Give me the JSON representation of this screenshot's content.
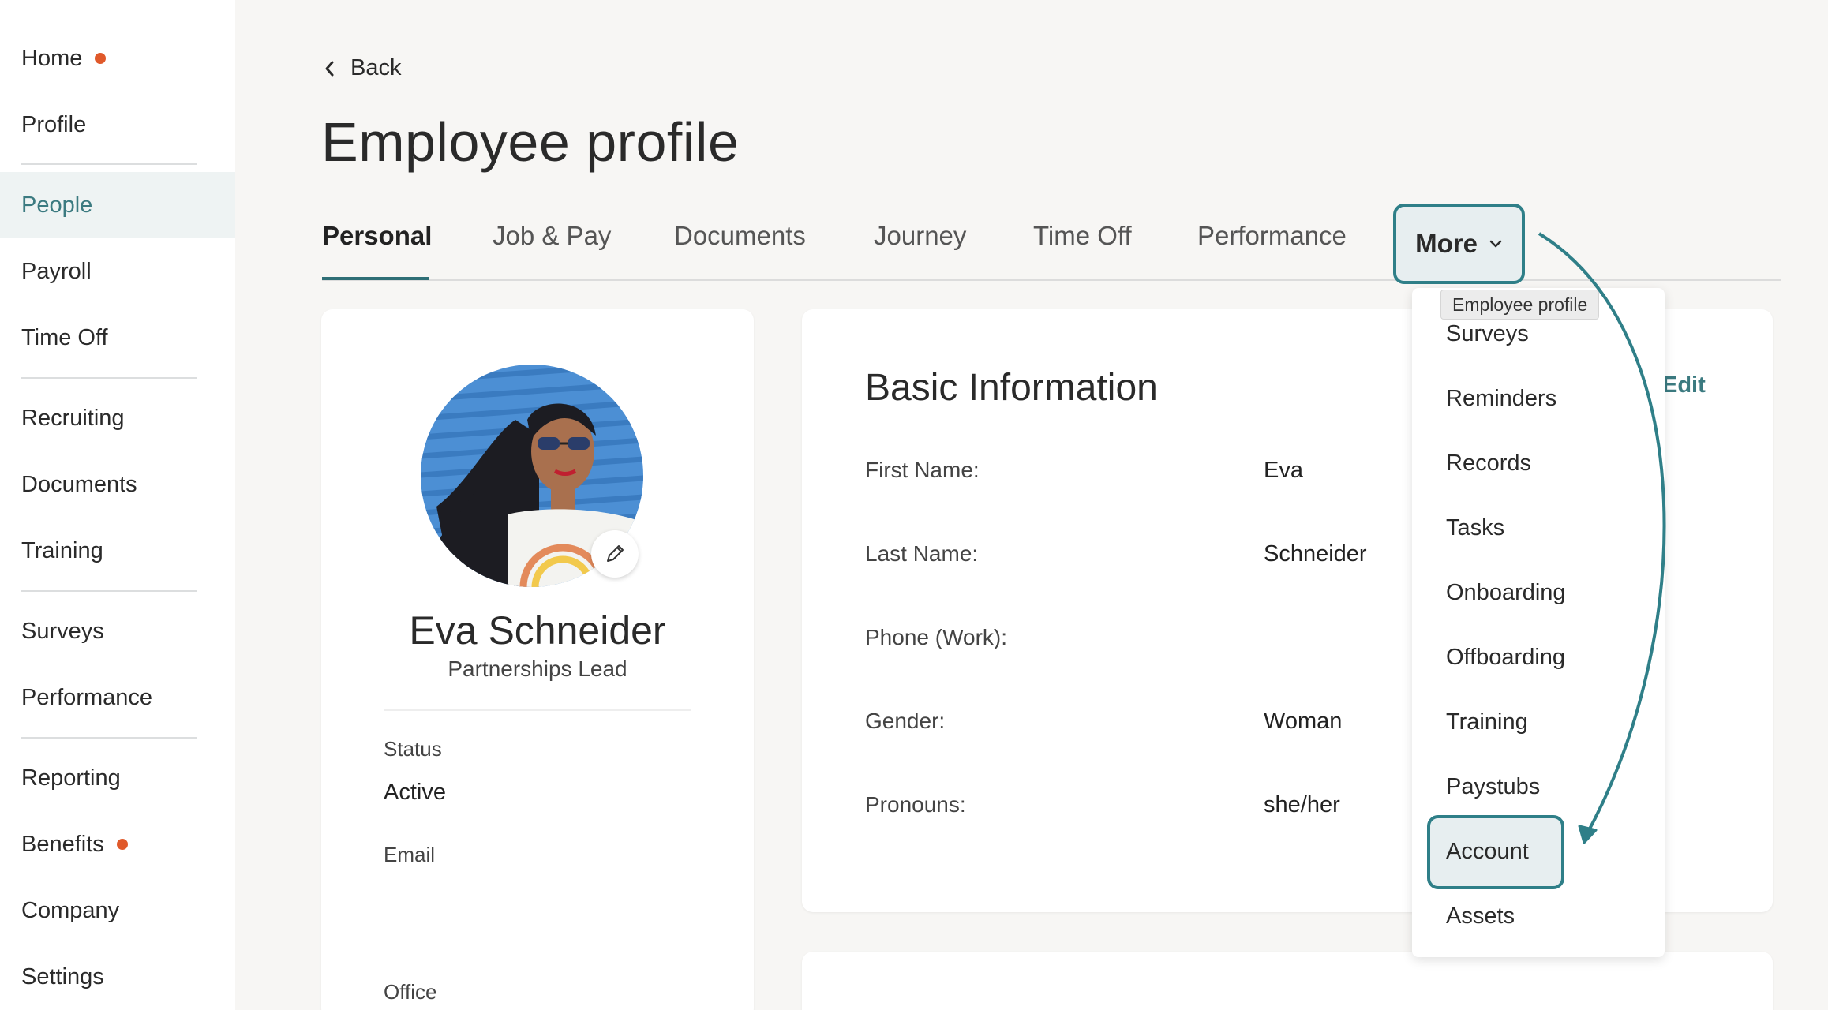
{
  "sidebar": {
    "items": [
      {
        "label": "Home",
        "badge": true
      },
      {
        "label": "Profile"
      },
      {
        "label": "People",
        "active": true
      },
      {
        "label": "Payroll"
      },
      {
        "label": "Time Off"
      },
      {
        "label": "Recruiting"
      },
      {
        "label": "Documents"
      },
      {
        "label": "Training"
      },
      {
        "label": "Surveys"
      },
      {
        "label": "Performance"
      },
      {
        "label": "Reporting"
      },
      {
        "label": "Benefits",
        "badge": true
      },
      {
        "label": "Company"
      },
      {
        "label": "Settings"
      }
    ]
  },
  "header": {
    "back_label": "Back",
    "title": "Employee profile"
  },
  "tabs": [
    {
      "label": "Personal",
      "active": true
    },
    {
      "label": "Job & Pay"
    },
    {
      "label": "Documents"
    },
    {
      "label": "Journey"
    },
    {
      "label": "Time Off"
    },
    {
      "label": "Performance"
    },
    {
      "label": "More"
    }
  ],
  "profile": {
    "name": "Eva Schneider",
    "title": "Partnerships Lead",
    "status_label": "Status",
    "status_value": "Active",
    "email_label": "Email",
    "office_label": "Office"
  },
  "basic_info": {
    "title": "Basic Information",
    "edit_label": "Edit",
    "fields": [
      {
        "label": "First Name:",
        "value": "Eva"
      },
      {
        "label": "Last Name:",
        "value": "Schneider"
      },
      {
        "label": "Phone (Work):",
        "value": ""
      },
      {
        "label": "Gender:",
        "value": "Woman"
      },
      {
        "label": "Pronouns:",
        "value": "she/her"
      }
    ]
  },
  "more_menu": {
    "tooltip": "Employee profile",
    "items": [
      "Surveys",
      "Reminders",
      "Records",
      "Tasks",
      "Onboarding",
      "Offboarding",
      "Training",
      "Paystubs",
      "Account",
      "Assets"
    ],
    "highlighted": "Account"
  },
  "colors": {
    "accent": "#2f7f88",
    "badge": "#e0592a",
    "active_nav_bg": "#eef3f3"
  }
}
